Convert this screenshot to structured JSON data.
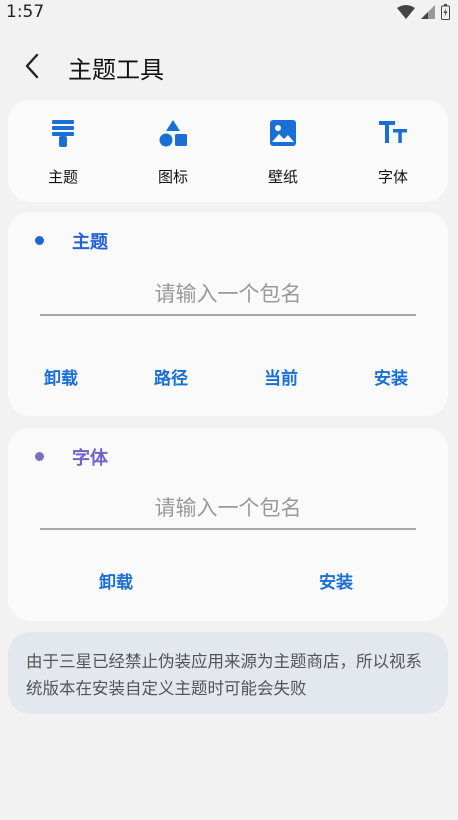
{
  "status_bar": {
    "time": "1:57"
  },
  "header": {
    "title": "主题工具"
  },
  "tools": [
    {
      "label": "主题",
      "icon": "paintbrush-icon"
    },
    {
      "label": "图标",
      "icon": "shapes-icon"
    },
    {
      "label": "壁纸",
      "icon": "image-icon"
    },
    {
      "label": "字体",
      "icon": "text-size-icon"
    }
  ],
  "theme_section": {
    "title": "主题",
    "input_placeholder": "请输入一个包名",
    "actions": [
      "卸载",
      "路径",
      "当前",
      "安装"
    ]
  },
  "font_section": {
    "title": "字体",
    "input_placeholder": "请输入一个包名",
    "actions": [
      "卸载",
      "安装"
    ]
  },
  "notice": {
    "text": "由于三星已经禁止伪装应用来源为主题商店，所以视系统版本在安装自定义主题时可能会失败"
  },
  "colors": {
    "accent_blue": "#1a6fd6",
    "theme_title": "#2463d6",
    "font_title": "#6f63c7",
    "font_dot": "#7b6dc6"
  }
}
